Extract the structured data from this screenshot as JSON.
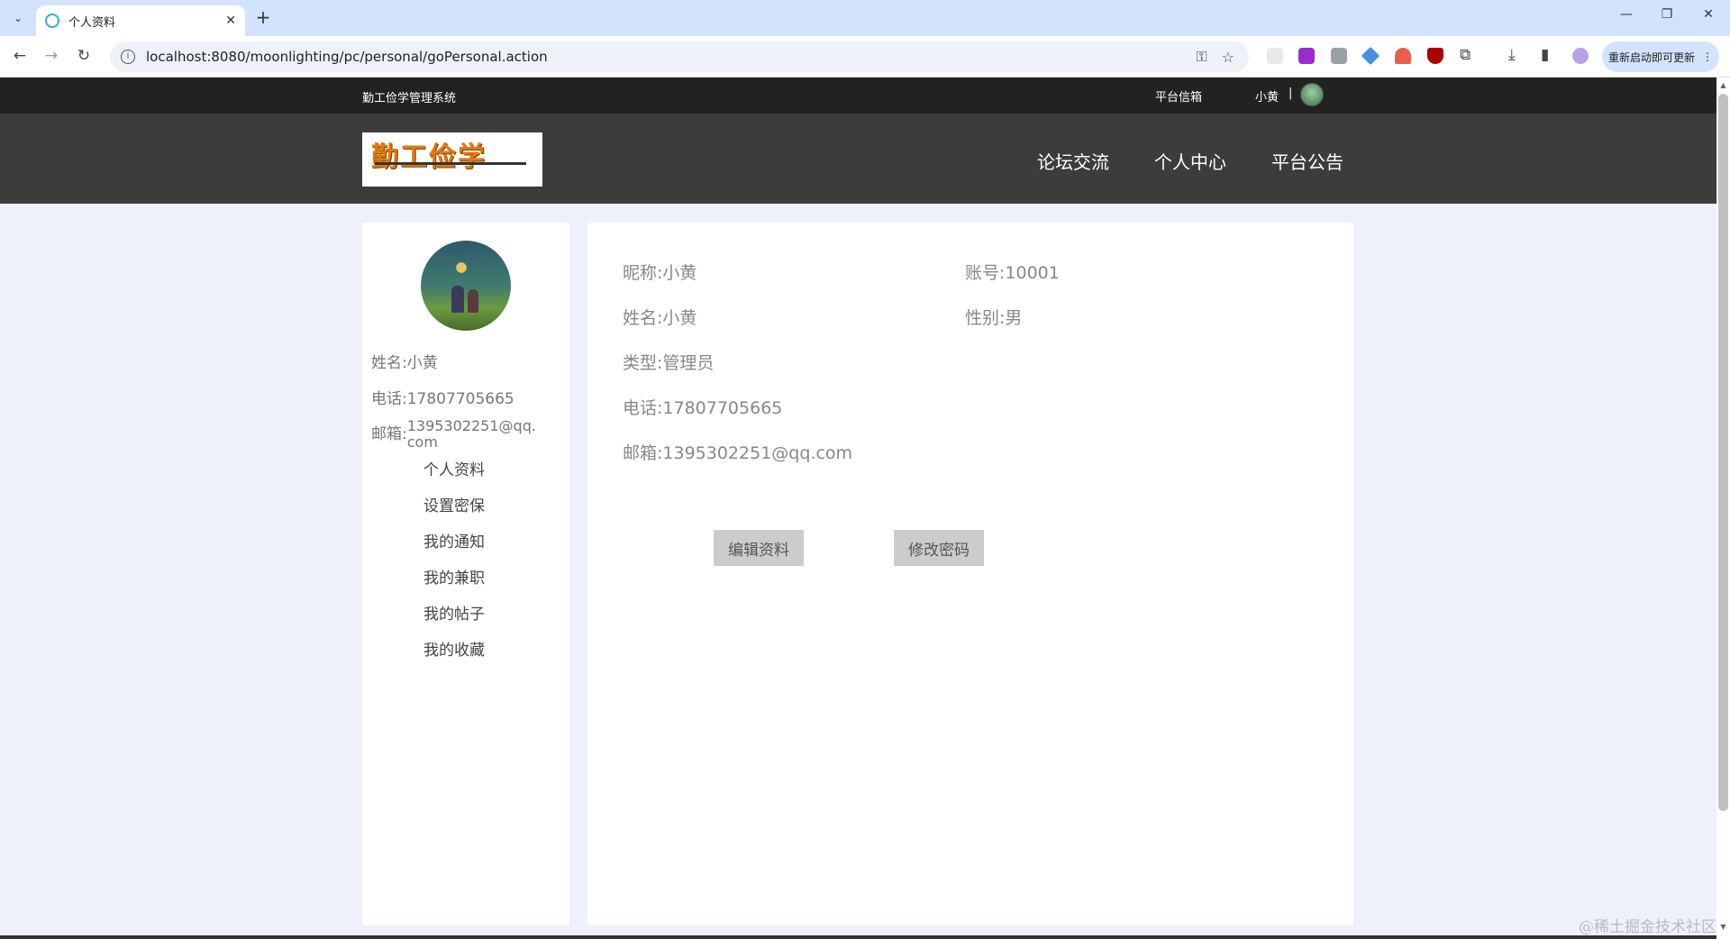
{
  "browser": {
    "tab_title": "个人资料",
    "url": "localhost:8080/moonlighting/pc/personal/goPersonal.action",
    "restart_label": "重新启动即可更新"
  },
  "site": {
    "system_name": "勤工俭学管理系统",
    "mailbox_label": "平台信箱",
    "current_user": "小黄",
    "separator": "|",
    "logo_text": "勤工俭学",
    "nav": [
      "论坛交流",
      "个人中心",
      "平台公告"
    ]
  },
  "sidebar": {
    "name_label": "姓名:",
    "name_value": "小黄",
    "phone_label": "电话:",
    "phone_value": "17807705665",
    "email_label": "邮箱:",
    "email_value": "1395302251@qq.com",
    "menu": [
      "个人资料",
      "设置密保",
      "我的通知",
      "我的兼职",
      "我的帖子",
      "我的收藏"
    ]
  },
  "profile": {
    "nickname_label": "昵称:",
    "nickname_value": "小黄",
    "account_label": "账号:",
    "account_value": "10001",
    "name_label": "姓名:",
    "name_value": "小黄",
    "gender_label": "性别:",
    "gender_value": "男",
    "type_label": "类型:",
    "type_value": "管理员",
    "phone_label": "电话:",
    "phone_value": "17807705665",
    "email_label": "邮箱:",
    "email_value": "1395302251@qq.com"
  },
  "actions": {
    "edit_label": "编辑资料",
    "password_label": "修改密码"
  },
  "watermark": "@稀土掘金技术社区"
}
